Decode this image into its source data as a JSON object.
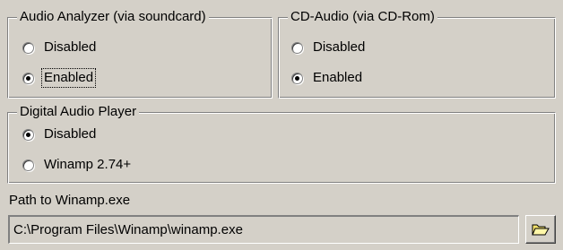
{
  "audio_analyzer": {
    "title": "Audio Analyzer (via soundcard)",
    "options": [
      {
        "label": "Disabled",
        "checked": false
      },
      {
        "label": "Enabled",
        "checked": true,
        "focused": true
      }
    ]
  },
  "cd_audio": {
    "title": "CD-Audio (via CD-Rom)",
    "options": [
      {
        "label": "Disabled",
        "checked": false
      },
      {
        "label": "Enabled",
        "checked": true
      }
    ]
  },
  "digital_audio_player": {
    "title": "Digital Audio Player",
    "options": [
      {
        "label": "Disabled",
        "checked": true
      },
      {
        "label": "Winamp 2.74+",
        "checked": false
      }
    ]
  },
  "winamp_path": {
    "label": "Path to Winamp.exe",
    "value": "C:\\Program Files\\Winamp\\winamp.exe"
  },
  "browse_button": {
    "icon": "folder-open-icon"
  },
  "colors": {
    "face": "#d4d0c8",
    "shadow": "#808080",
    "highlight": "#ffffff",
    "folder": "#f5e26b"
  }
}
